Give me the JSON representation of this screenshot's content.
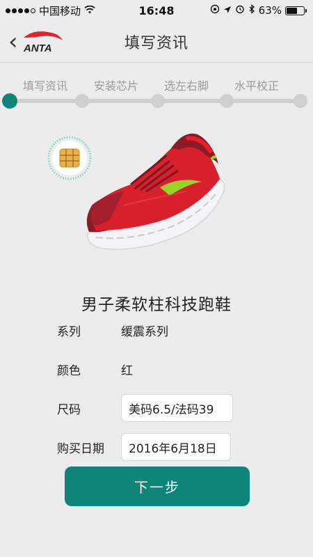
{
  "status_bar": {
    "carrier": "中国移动",
    "time": "16:48",
    "battery": "63%",
    "battery_level": 0.63,
    "signal_bars": 5,
    "signal_filled": 4
  },
  "nav": {
    "title": "填写资讯",
    "logo_text": "ANTA",
    "brand_color": "#e8202a"
  },
  "steps": [
    {
      "label": "填写资讯",
      "active": true
    },
    {
      "label": "安装芯片",
      "active": false
    },
    {
      "label": "选左右脚",
      "active": false
    },
    {
      "label": "水平校正",
      "active": false
    }
  ],
  "product": {
    "name": "男子柔软柱科技跑鞋",
    "series_label": "系列",
    "series_value": "缓震系列",
    "color_label": "颜色",
    "color_value": "红",
    "size_label": "尺码",
    "size_value": "美码6.5/法码39",
    "date_label": "购买日期",
    "date_value": "2016年6月18日"
  },
  "actions": {
    "next_label": "下一步"
  },
  "colors": {
    "accent": "#0f8479",
    "shoe_red": "#d8202c",
    "shoe_dark": "#8c1b2a",
    "shoe_lime": "#9ad328"
  }
}
